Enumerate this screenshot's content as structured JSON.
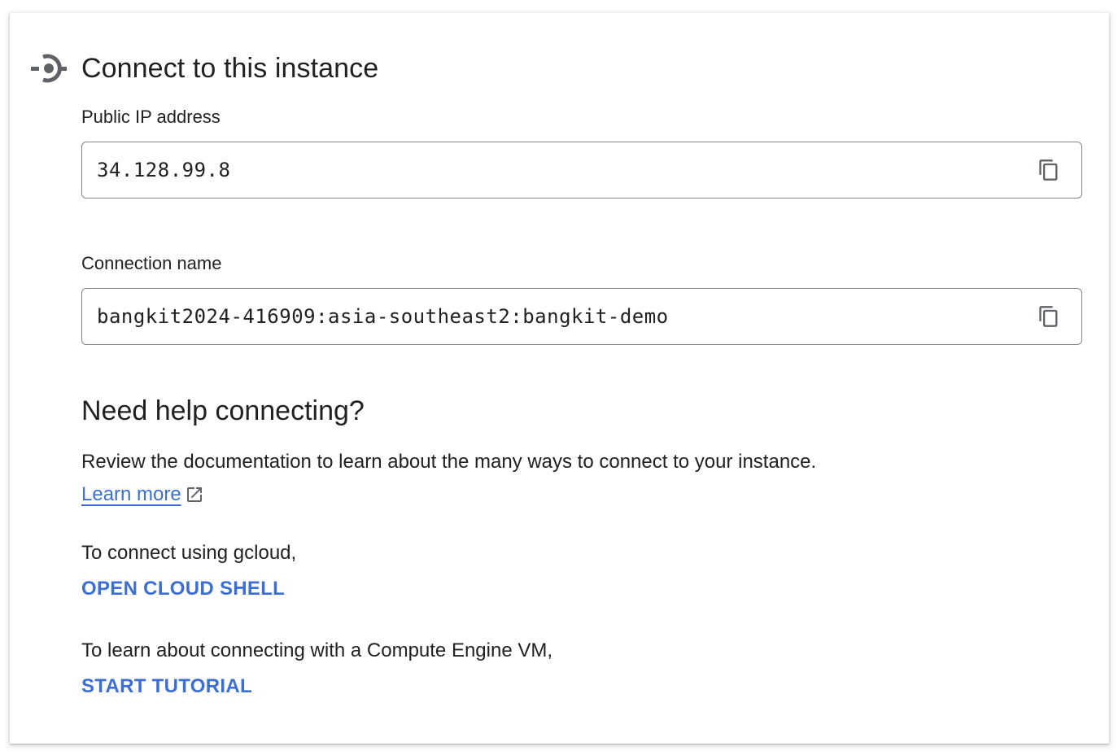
{
  "header": {
    "title": "Connect to this instance",
    "icon": "connection-icon"
  },
  "public_ip": {
    "label": "Public IP address",
    "value": "34.128.99.8",
    "copy_icon": "copy-icon"
  },
  "connection_name": {
    "label": "Connection name",
    "value": "bangkit2024-416909:asia-southeast2:bangkit-demo",
    "copy_icon": "copy-icon"
  },
  "help": {
    "title": "Need help connecting?",
    "description": "Review the documentation to learn about the many ways to connect to your instance.",
    "learn_more": "Learn more",
    "learn_more_icon": "open-in-new-icon",
    "gcloud_text": "To connect using gcloud,",
    "gcloud_action": "OPEN CLOUD SHELL",
    "vm_text": "To learn about connecting with a Compute Engine VM,",
    "vm_action": "START TUTORIAL"
  },
  "colors": {
    "link": "#3c6fd1",
    "text": "#202124",
    "border": "#80868b",
    "icon": "#5f6368"
  }
}
